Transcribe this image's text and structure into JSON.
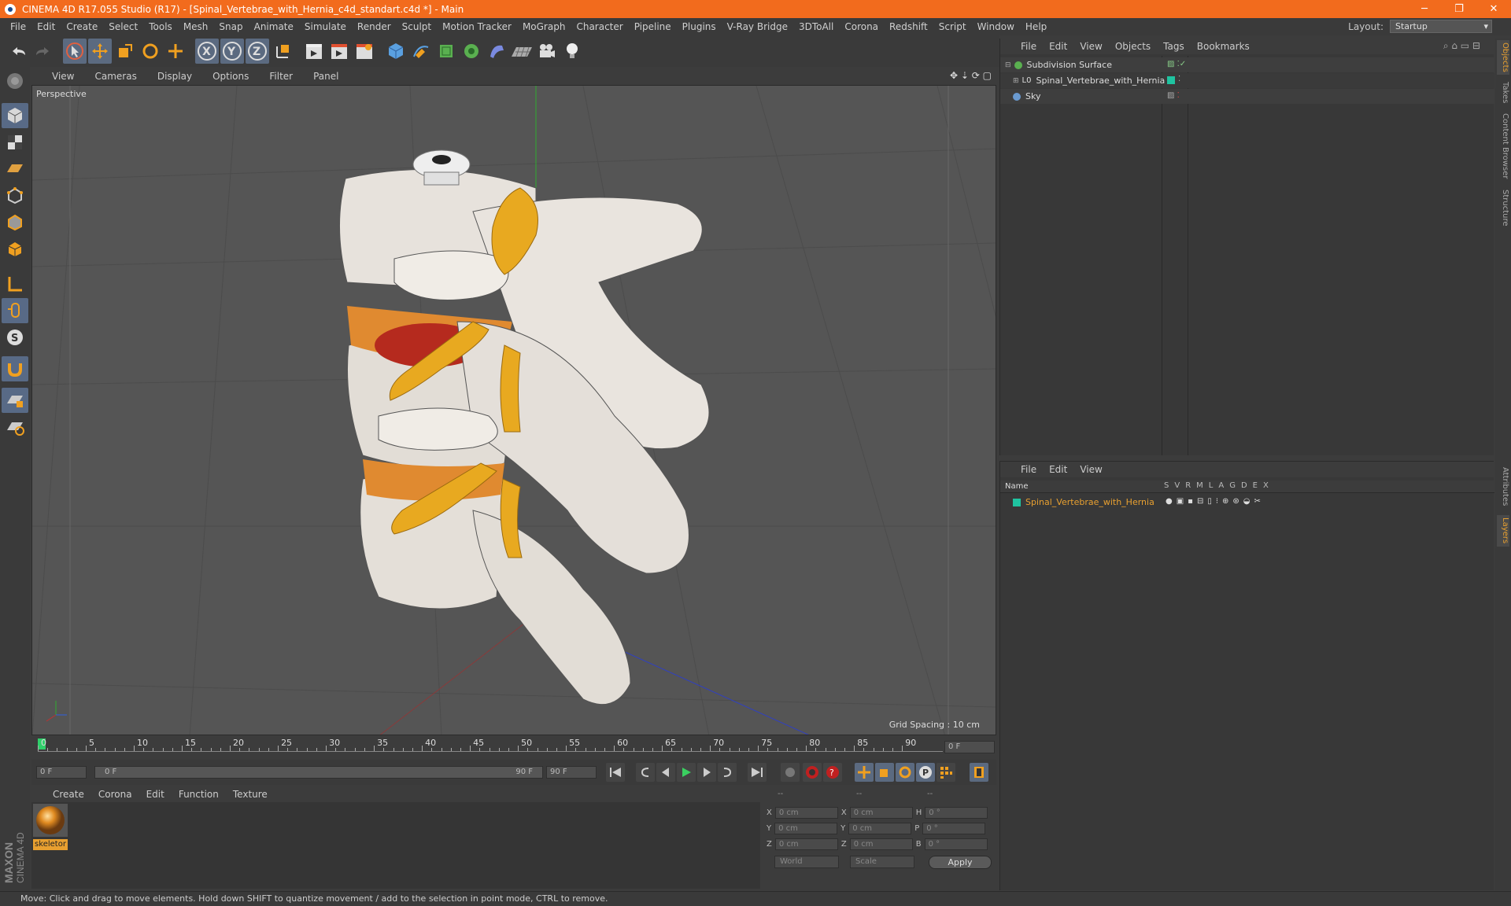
{
  "titlebar": {
    "title": "CINEMA 4D R17.055 Studio (R17) - [Spinal_Vertebrae_with_Hernia_c4d_standart.c4d *] - Main",
    "min": "─",
    "max": "❐",
    "close": "✕"
  },
  "menubar": {
    "items": [
      "File",
      "Edit",
      "Create",
      "Select",
      "Tools",
      "Mesh",
      "Snap",
      "Animate",
      "Simulate",
      "Render",
      "Sculpt",
      "Motion Tracker",
      "MoGraph",
      "Character",
      "Pipeline",
      "Plugins",
      "V-Ray Bridge",
      "3DToAll",
      "Corona",
      "Redshift",
      "Script",
      "Window",
      "Help"
    ],
    "layout_label": "Layout:",
    "layout_value": "Startup"
  },
  "viewport": {
    "menu": [
      "View",
      "Cameras",
      "Display",
      "Options",
      "Filter",
      "Panel"
    ],
    "camera_label": "Perspective",
    "grid_spacing": "Grid Spacing : 10 cm"
  },
  "timeline": {
    "ticks": [
      "0",
      "5",
      "10",
      "15",
      "20",
      "25",
      "30",
      "35",
      "40",
      "45",
      "50",
      "55",
      "60",
      "65",
      "70",
      "75",
      "80",
      "85",
      "90"
    ],
    "current_frame": "0 F"
  },
  "transport": {
    "start": "0 F",
    "range_start": "0 F",
    "range_end": "90 F",
    "end": "90 F"
  },
  "materials": {
    "menu": [
      "Create",
      "Corona",
      "Edit",
      "Function",
      "Texture"
    ],
    "items": [
      {
        "name": "skeletor"
      }
    ]
  },
  "coords": {
    "headers": [
      "--",
      "--",
      "--"
    ],
    "rows": [
      {
        "a": "X",
        "av": "0 cm",
        "b": "X",
        "bv": "0 cm",
        "c": "H",
        "cv": "0 °"
      },
      {
        "a": "Y",
        "av": "0 cm",
        "b": "Y",
        "bv": "0 cm",
        "c": "P",
        "cv": "0 °"
      },
      {
        "a": "Z",
        "av": "0 cm",
        "b": "Z",
        "bv": "0 cm",
        "c": "B",
        "cv": "0 °"
      }
    ],
    "world": "World",
    "scale": "Scale",
    "apply": "Apply"
  },
  "objects": {
    "menu": [
      "File",
      "Edit",
      "View",
      "Objects",
      "Tags",
      "Bookmarks"
    ],
    "items": [
      {
        "name": "Subdivision Surface"
      },
      {
        "name": "Spinal_Vertebrae_with_Hernia"
      },
      {
        "name": "Sky"
      }
    ]
  },
  "layers": {
    "menu": [
      "File",
      "Edit",
      "View"
    ],
    "name_header": "Name",
    "col_headers": [
      "S",
      "V",
      "R",
      "M",
      "L",
      "A",
      "G",
      "D",
      "E",
      "X"
    ],
    "items": [
      {
        "name": "Spinal_Vertebrae_with_Hernia"
      }
    ]
  },
  "righttabs": [
    "Objects",
    "Takes",
    "Content Browser",
    "Structure",
    "Attributes",
    "Layers"
  ],
  "statusbar": {
    "text": "Move: Click and drag to move elements. Hold down SHIFT to quantize movement / add to the selection in point mode, CTRL to remove."
  },
  "brand": {
    "line1": "MAXON",
    "line2": "CINEMA 4D"
  },
  "colors": {
    "accent": "#f26b1d",
    "layer_color": "#1fc3a0",
    "bone": "#e7e2dc",
    "nerve": "#e8a920",
    "disc": "#e08a30",
    "hernia": "#b52a1e"
  }
}
